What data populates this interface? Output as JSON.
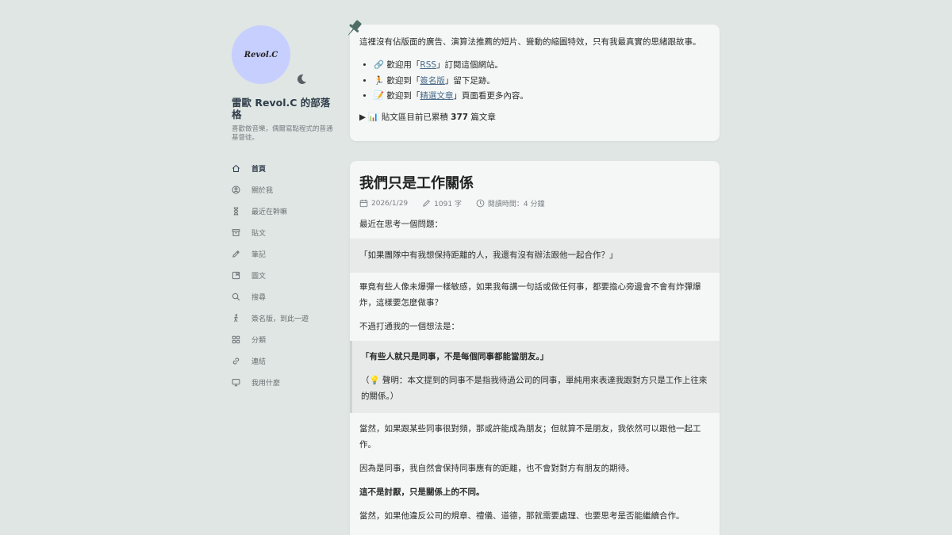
{
  "site": {
    "avatar_text": "Revol.C",
    "title": "雷歐 Revol.C 的部落格",
    "description": "喜歡做音樂，偶爾寫點程式的普通基督徒。"
  },
  "nav": [
    {
      "label": "首頁",
      "icon": "home-icon",
      "active": true
    },
    {
      "label": "關於我",
      "icon": "user-circle-icon"
    },
    {
      "label": "最近在幹嘛",
      "icon": "hourglass-icon"
    },
    {
      "label": "貼文",
      "icon": "archive-icon"
    },
    {
      "label": "筆記",
      "icon": "pencil-icon"
    },
    {
      "label": "圖文",
      "icon": "photo-icon"
    },
    {
      "label": "搜尋",
      "icon": "search-icon"
    },
    {
      "label": "簽名版，到此一遊",
      "icon": "walk-icon"
    },
    {
      "label": "分類",
      "icon": "category-icon"
    },
    {
      "label": "連結",
      "icon": "link-icon"
    },
    {
      "label": "我用什麼",
      "icon": "monitor-icon"
    }
  ],
  "intro": {
    "text": "這裡沒有佔版面的廣告、演算法推薦的短片、聳動的縮圖特效，只有我最真實的思緒跟故事。",
    "items": [
      {
        "emoji": "🔗",
        "before": " 歡迎用「",
        "link": "RSS",
        "after": "」訂閱這個網站。"
      },
      {
        "emoji": "🏃",
        "before": " 歡迎到「",
        "link": "簽名版",
        "after": "」留下足跡。"
      },
      {
        "emoji": "📝",
        "before": " 歡迎到「",
        "link": "精選文章",
        "after": "」頁面看更多內容。"
      }
    ],
    "summary_prefix": "📊 貼文區目前已累積 ",
    "summary_count": "377",
    "summary_suffix": " 篇文章"
  },
  "post": {
    "title": "我們只是工作關係",
    "date": "2026/1/29",
    "words": "1091 字",
    "read_time": "閱讀時間：4 分鐘",
    "p1": "最近在思考一個問題：",
    "quote1": "「如果團隊中有我想保持距離的人，我還有沒有辦法跟他一起合作？」",
    "p2": "畢竟有些人像未爆彈一樣敏感，如果我每講一句話或做任何事，都要擔心旁邊會不會有炸彈爆炸，這樣要怎麼做事？",
    "p3": "不過打通我的一個想法是：",
    "quote2_bold": "「有些人就只是同事，不是每個同事都能當朋友。」",
    "quote2_note": "（💡 聲明：本文提到的同事不是指我待過公司的同事，單純用來表達我跟對方只是工作上往來的關係。）",
    "p4": "當然，如果跟某些同事很對頻，那或許能成為朋友；但就算不是朋友，我依然可以跟他一起工作。",
    "p5": "因為是同事，我自然會保持同事應有的距離，也不會對對方有朋友的期待。",
    "p6": "這不是討厭，只是關係上的不同。",
    "p7": "當然，如果他違反公司的規章、禮儀、道德，那就需要處理、也要思考是否能繼續合作。"
  },
  "colors": {
    "background": "#dfe6e3",
    "card": "#f4f7f6",
    "avatar": "#c7cffe",
    "pin": "#4e6e66",
    "link": "#4a6a8a"
  }
}
